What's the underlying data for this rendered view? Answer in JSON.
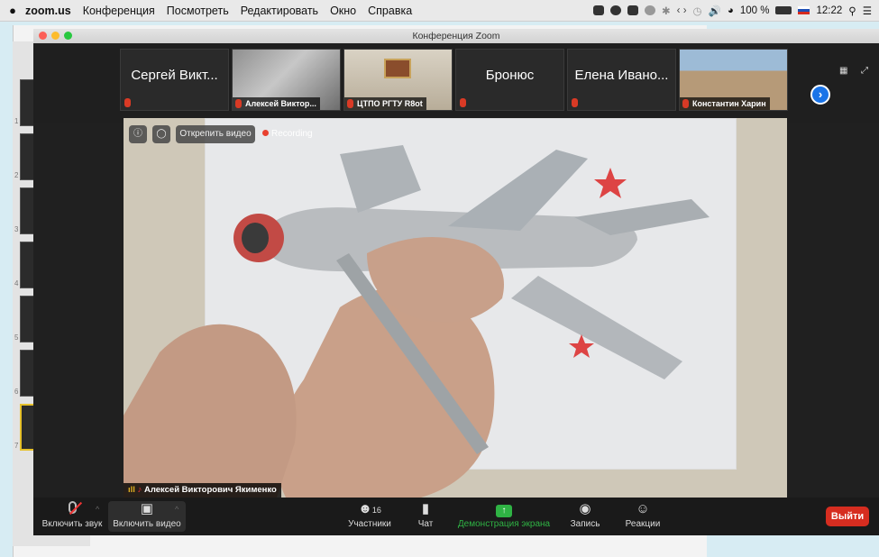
{
  "menubar": {
    "app": "zoom.us",
    "items": [
      "Конференция",
      "Посмотреть",
      "Редактировать",
      "Окно",
      "Справка"
    ],
    "battery": "100 %",
    "time": "12:22"
  },
  "window": {
    "title": "Конференция Zoom"
  },
  "background_slide_numbers": [
    "1",
    "2",
    "3",
    "4",
    "5",
    "6",
    "7"
  ],
  "thumbnails": [
    {
      "name": "Сергей Викт..."
    },
    {
      "name": "Алексей Виктор..."
    },
    {
      "name": "ЦТПО РГТУ R8ot"
    },
    {
      "name": "Бронюс"
    },
    {
      "name": "Елена Ивано..."
    },
    {
      "name": "Константин Харин"
    }
  ],
  "video": {
    "unpin_label": "Открепить видео",
    "recording_label": "Recording",
    "speaker_name": "Алексей Викторович Якименко"
  },
  "toolbar": {
    "mute_label": "Включить звук",
    "video_label": "Включить видео",
    "participants_label": "Участники",
    "participants_count": "16",
    "chat_label": "Чат",
    "share_label": "Демонстрация экрана",
    "record_label": "Запись",
    "reactions_label": "Реакции",
    "leave_label": "Выйти"
  },
  "colors": {
    "leave": "#d62d20",
    "share": "#2fb344",
    "next": "#1a74e8",
    "recording_dot": "#e8402f"
  }
}
